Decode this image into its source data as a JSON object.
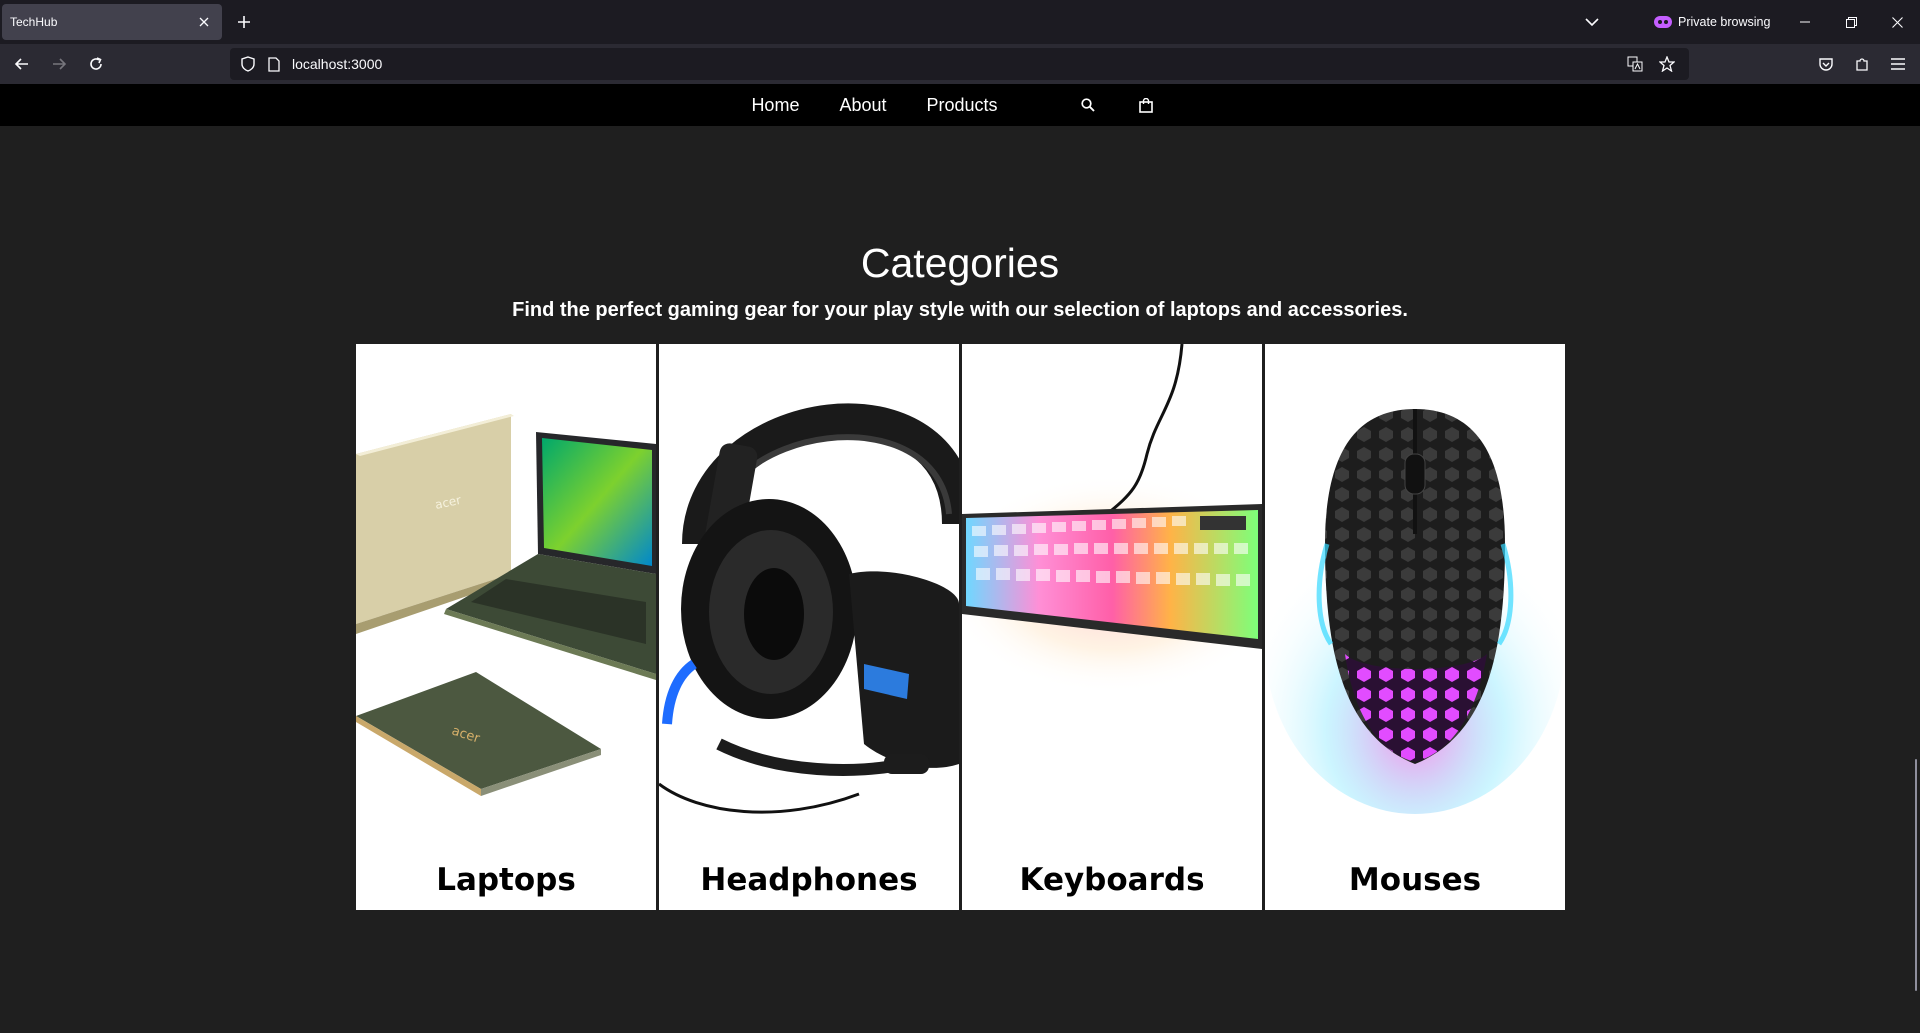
{
  "browser": {
    "tab_title": "TechHub",
    "url": "localhost:3000",
    "private_label": "Private browsing"
  },
  "site_nav": {
    "links": [
      "Home",
      "About",
      "Products"
    ],
    "icons": [
      "search-icon",
      "shopping-bag-icon"
    ]
  },
  "categories": {
    "title": "Categories",
    "subtitle": "Find the perfect gaming gear for your play style with our selection of laptops and accessories.",
    "items": [
      {
        "label": "Laptops",
        "image": "laptop-image"
      },
      {
        "label": "Headphones",
        "image": "headphones-image"
      },
      {
        "label": "Keyboards",
        "image": "keyboard-image"
      },
      {
        "label": "Mouses",
        "image": "mouse-image"
      }
    ]
  },
  "colors": {
    "browser_bg": "#1c1b22",
    "tab_active": "#42414d",
    "page_bg": "#1f1f1f",
    "nav_bg": "#000000",
    "card_bg": "#ffffff",
    "private_accent": "#c45eff"
  }
}
